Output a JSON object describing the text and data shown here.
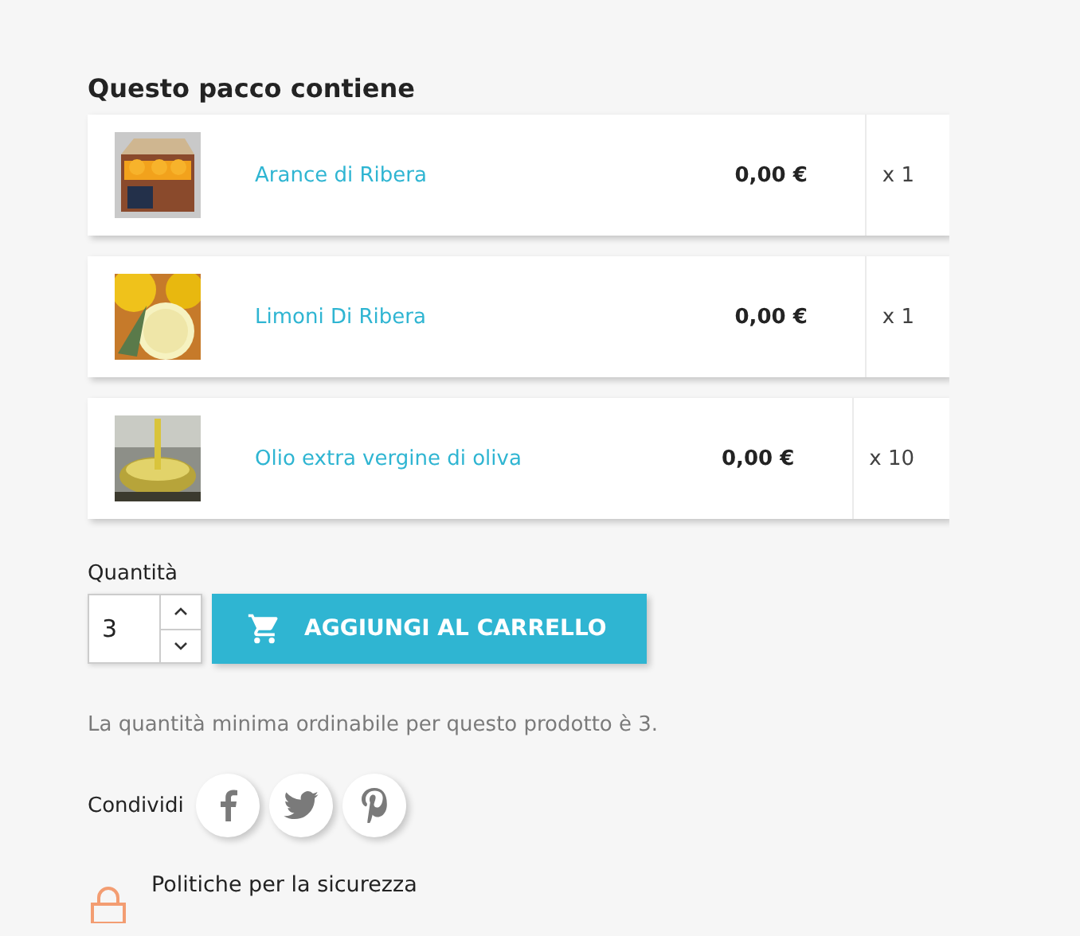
{
  "pack": {
    "title": "Questo pacco contiene",
    "items": [
      {
        "kind": "oranges",
        "name": "Arance di Ribera",
        "price": "0,00 €",
        "quantity": "x 1"
      },
      {
        "kind": "lemons",
        "name": "Limoni Di Ribera",
        "price": "0,00 €",
        "quantity": "x 1"
      },
      {
        "kind": "oil",
        "name": "Olio extra vergine di oliva",
        "price": "0,00 €",
        "quantity": "x 10"
      }
    ]
  },
  "quantity": {
    "label": "Quantità",
    "value": "3"
  },
  "add_to_cart": "AGGIUNGI AL CARRELLO",
  "minimum_note": "La quantità minima ordinabile per questo prodotto è 3.",
  "share": {
    "label": "Condividi",
    "buttons": [
      {
        "kind": "facebook"
      },
      {
        "kind": "twitter"
      },
      {
        "kind": "pinterest"
      }
    ]
  },
  "policy": "Politiche per la sicurezza"
}
